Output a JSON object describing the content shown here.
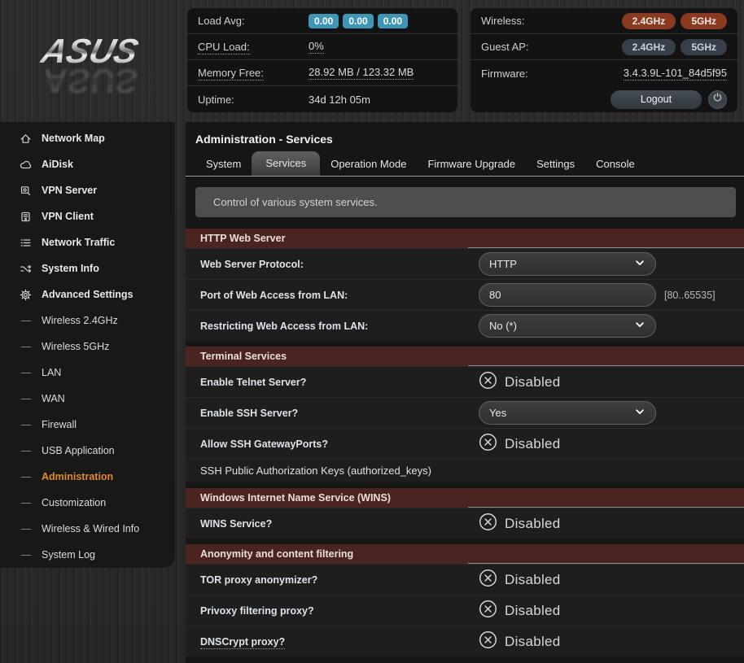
{
  "header": {
    "logo": "ASUS",
    "status_panel": {
      "rows": [
        {
          "label": "Load Avg:",
          "badges": [
            "0.00",
            "0.00",
            "0.00"
          ]
        },
        {
          "label": "CPU Load:",
          "value": "0%",
          "dotted_label": true,
          "dotted_value": true
        },
        {
          "label": "Memory Free:",
          "value": "28.92 MB / 123.32 MB",
          "dotted_label": true,
          "dotted_value": true
        },
        {
          "label": "Uptime:",
          "value": "34d 12h 05m"
        }
      ]
    },
    "wireless_panel": {
      "rows": [
        {
          "label": "Wireless:",
          "badges": [
            "2.4GHz",
            "5GHz"
          ],
          "badge_style": "on"
        },
        {
          "label": "Guest AP:",
          "badges": [
            "2.4GHz",
            "5GHz"
          ],
          "badge_style": "off"
        },
        {
          "label": "Firmware:",
          "value": "3.4.3.9L-101_84d5f95",
          "dotted_value": true
        }
      ],
      "logout_label": "Logout",
      "power_icon": "power-icon"
    }
  },
  "sidebar": {
    "items": [
      {
        "icon": "home-icon",
        "label": "Network Map",
        "type": "top"
      },
      {
        "icon": "cloud-icon",
        "label": "AiDisk",
        "type": "top"
      },
      {
        "icon": "vpn-server-icon",
        "label": "VPN Server",
        "type": "top"
      },
      {
        "icon": "vpn-client-icon",
        "label": "VPN Client",
        "type": "top"
      },
      {
        "icon": "network-traffic-icon",
        "label": "Network Traffic",
        "type": "top"
      },
      {
        "icon": "system-info-icon",
        "label": "System Info",
        "type": "top"
      },
      {
        "icon": "gear-icon",
        "label": "Advanced Settings",
        "type": "top"
      },
      {
        "label": "Wireless 2.4GHz",
        "type": "sub"
      },
      {
        "label": "Wireless 5GHz",
        "type": "sub"
      },
      {
        "label": "LAN",
        "type": "sub"
      },
      {
        "label": "WAN",
        "type": "sub"
      },
      {
        "label": "Firewall",
        "type": "sub"
      },
      {
        "label": "USB Application",
        "type": "sub"
      },
      {
        "label": "Administration",
        "type": "sub",
        "active": true
      },
      {
        "label": "Customization",
        "type": "sub"
      },
      {
        "label": "Wireless & Wired Info",
        "type": "sub"
      },
      {
        "label": "System Log",
        "type": "sub"
      }
    ]
  },
  "main": {
    "title": "Administration - Services",
    "tabs": [
      "System",
      "Services",
      "Operation Mode",
      "Firmware Upgrade",
      "Settings",
      "Console"
    ],
    "active_tab": "Services",
    "description": "Control of various system services.",
    "sections": [
      {
        "header": "HTTP Web Server",
        "rows": [
          {
            "label": "Web Server Protocol:",
            "control": "select",
            "value": "HTTP"
          },
          {
            "label": "Port of Web Access from LAN:",
            "control": "input",
            "value": "80",
            "hint": "[80..65535]"
          },
          {
            "label": "Restricting Web Access from LAN:",
            "control": "select",
            "value": "No (*)"
          }
        ]
      },
      {
        "header": "Terminal Services",
        "rows": [
          {
            "label": "Enable Telnet Server?",
            "control": "status",
            "value": "Disabled",
            "status_icon": "x-circle-icon"
          },
          {
            "label": "Enable SSH Server?",
            "control": "select",
            "value": "Yes"
          },
          {
            "label": "Allow SSH GatewayPorts?",
            "control": "status",
            "value": "Disabled",
            "status_icon": "x-circle-icon"
          },
          {
            "label": "SSH Public Authorization Keys (authorized_keys)",
            "control": "none",
            "plain": true
          }
        ]
      },
      {
        "header": "Windows Internet Name Service (WINS)",
        "rows": [
          {
            "label": "WINS Service?",
            "control": "status",
            "value": "Disabled",
            "status_icon": "x-circle-icon"
          }
        ]
      },
      {
        "header": "Anonymity and content filtering",
        "rows": [
          {
            "label": "TOR proxy anonymizer?",
            "control": "status",
            "value": "Disabled",
            "status_icon": "x-circle-icon"
          },
          {
            "label": "Privoxy filtering proxy?",
            "control": "status",
            "value": "Disabled",
            "status_icon": "x-circle-icon"
          },
          {
            "label": "DNSCrypt proxy?",
            "control": "status",
            "value": "Disabled",
            "status_icon": "x-circle-icon",
            "dotted_label": true
          }
        ]
      }
    ]
  },
  "colors": {
    "accent_orange": "#e0892a",
    "section_header_maroon": "#4a2421",
    "badge_blue": "#3e95b5",
    "badge_red": "#8a3a20",
    "badge_slate": "#37404a",
    "panel_bg": "#131313",
    "content_bg": "#161616"
  }
}
